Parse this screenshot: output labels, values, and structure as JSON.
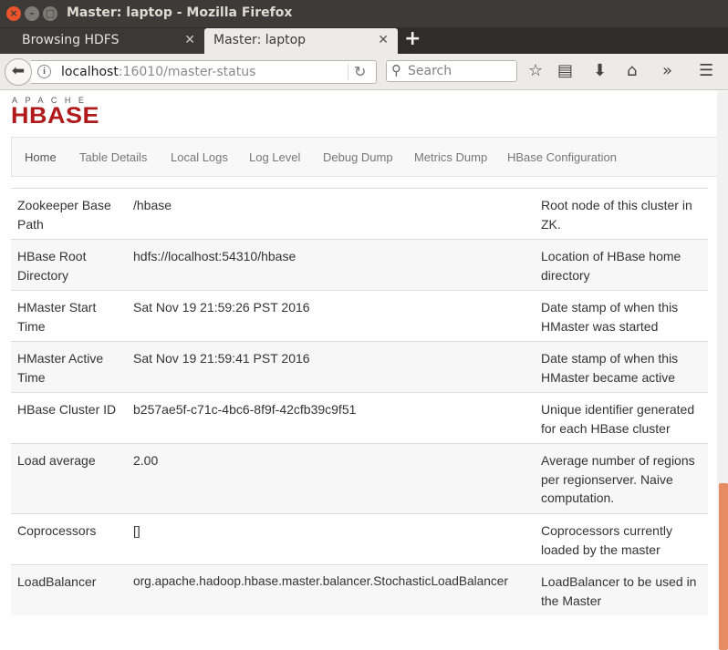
{
  "window": {
    "title": "Master: laptop - Mozilla Firefox"
  },
  "tabs": [
    {
      "label": "Browsing HDFS",
      "active": false
    },
    {
      "label": "Master: laptop",
      "active": true
    }
  ],
  "nav": {
    "url_host": "localhost",
    "url_path": ":16010/master-status",
    "search_placeholder": "Search"
  },
  "logo": {
    "top_text": "APACHE",
    "main_text": "HBASE"
  },
  "menu": [
    "Home",
    "Table Details",
    "Local Logs",
    "Log Level",
    "Debug Dump",
    "Metrics Dump",
    "HBase Configuration"
  ],
  "attributes": [
    {
      "name": "Zookeeper Base Path",
      "value": "/hbase",
      "description": "Root node of this cluster in ZK."
    },
    {
      "name": "HBase Root Directory",
      "value": "hdfs://localhost:54310/hbase",
      "description": "Location of HBase home directory"
    },
    {
      "name": "HMaster Start Time",
      "value": "Sat Nov 19 21:59:26 PST 2016",
      "description": "Date stamp of when this HMaster was started"
    },
    {
      "name": "HMaster Active Time",
      "value": "Sat Nov 19 21:59:41 PST 2016",
      "description": "Date stamp of when this HMaster became active"
    },
    {
      "name": "HBase Cluster ID",
      "value": "b257ae5f-c71c-4bc6-8f9f-42cfb39c9f51",
      "description": "Unique identifier generated for each HBase cluster"
    },
    {
      "name": "Load average",
      "value": "2.00",
      "description": "Average number of regions per regionserver. Naive computation."
    },
    {
      "name": "Coprocessors",
      "value": "[]",
      "description": "Coprocessors currently loaded by the master"
    },
    {
      "name": "LoadBalancer",
      "value": "org.apache.hadoop.hbase.master.balancer.StochasticLoadBalancer",
      "description": "LoadBalancer to be used in the Master"
    }
  ]
}
